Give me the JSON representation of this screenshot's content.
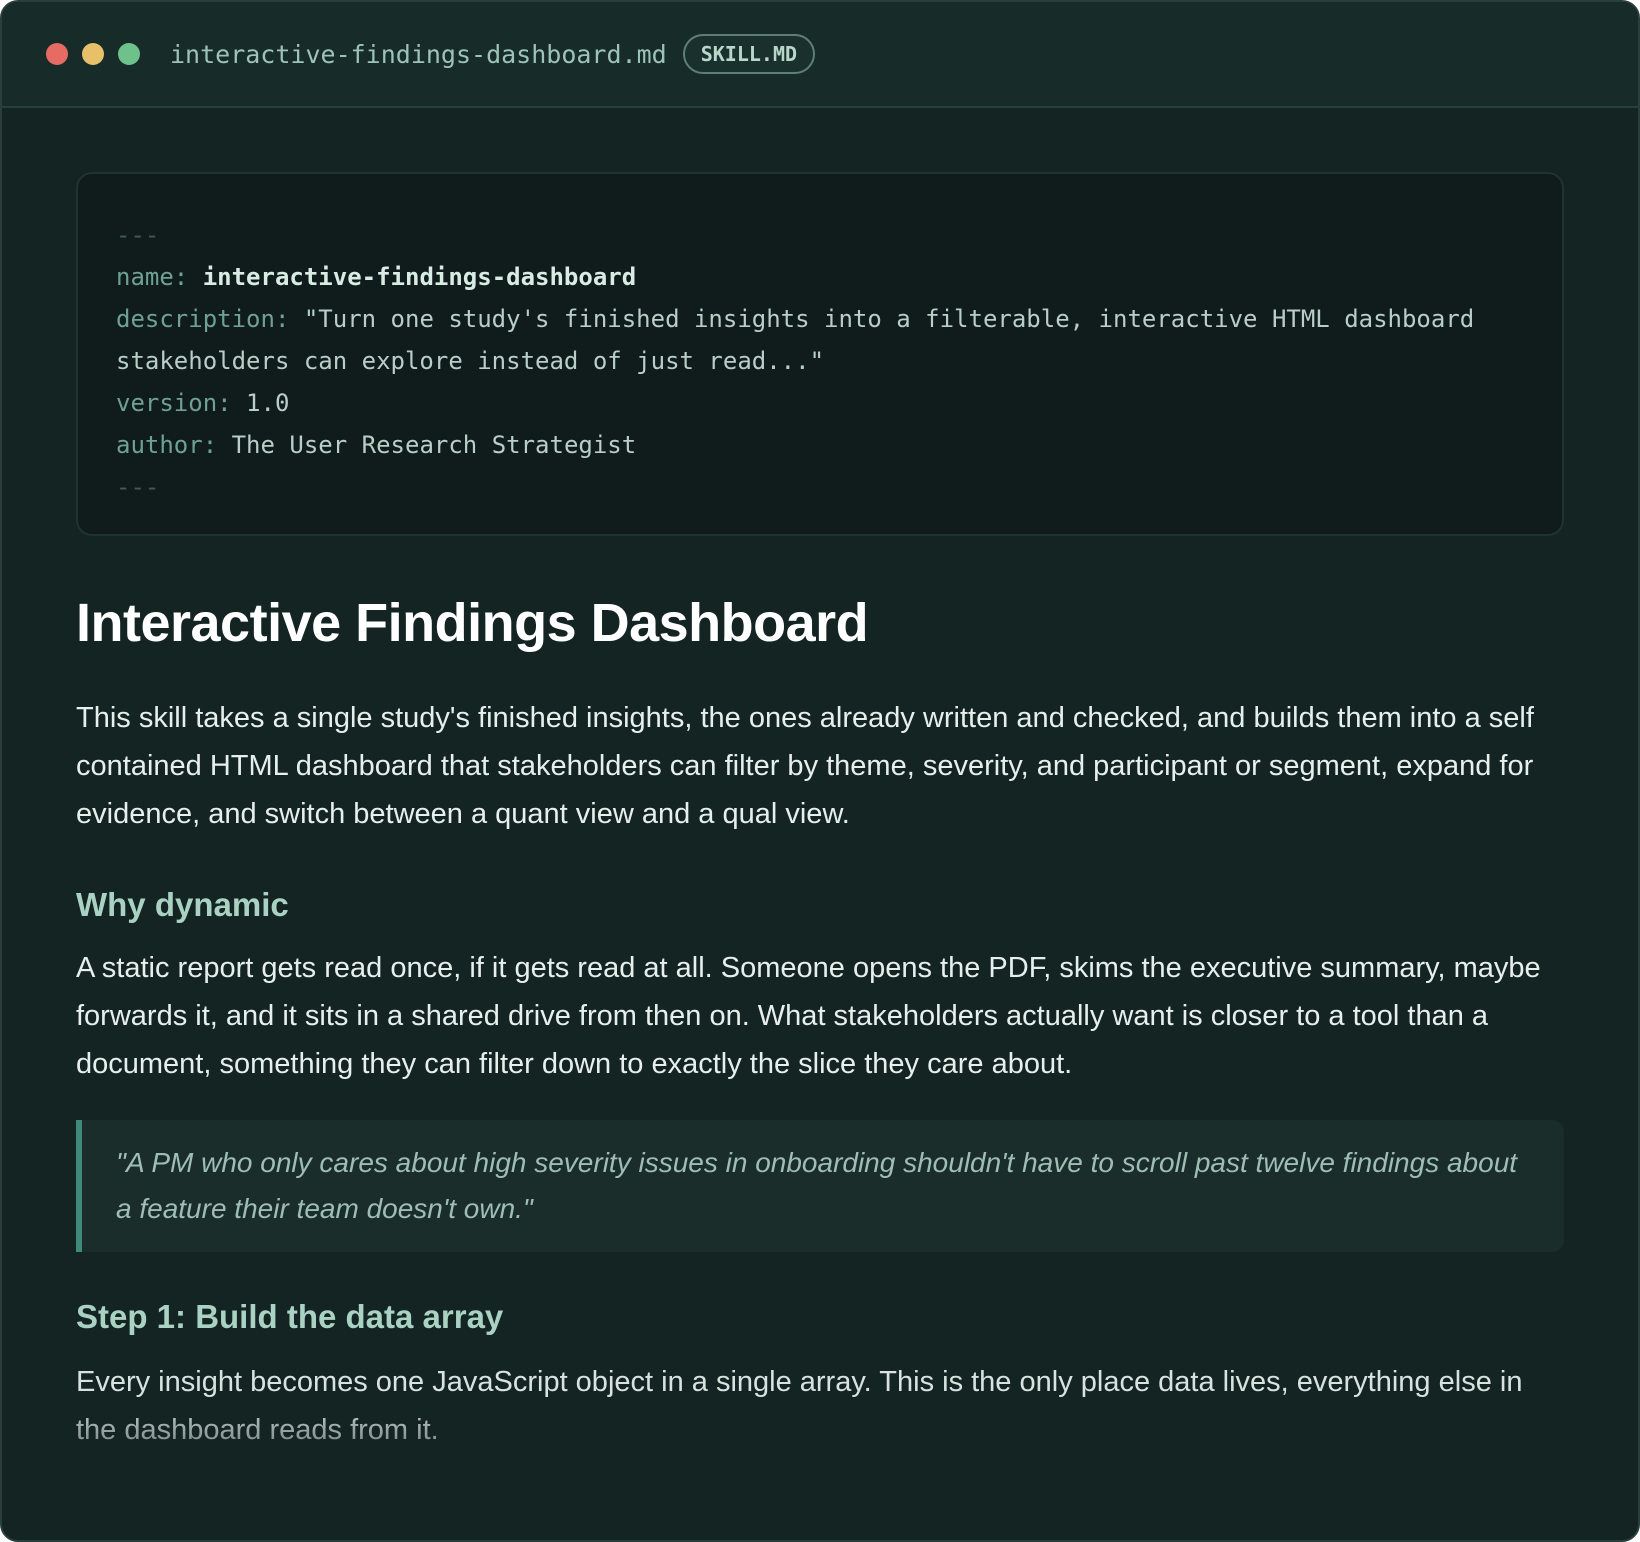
{
  "window": {
    "filename": "interactive-findings-dashboard.md",
    "badge": "SKILL.MD",
    "traffic_lights": [
      "red",
      "yellow",
      "green"
    ]
  },
  "frontmatter": {
    "delimiter": "---",
    "name_key": "name:",
    "name_value": "interactive-findings-dashboard",
    "description_key": "description:",
    "description_value": "\"Turn one study's finished insights into a filterable, interactive HTML dashboard stakeholders can explore instead of just read...\"",
    "version_key": "version:",
    "version_value": "1.0",
    "author_key": "author:",
    "author_value": "The User Research Strategist"
  },
  "doc": {
    "title": "Interactive Findings Dashboard",
    "intro": "This skill takes a single study's finished insights, the ones already written and checked, and builds them into a self contained HTML dashboard that stakeholders can filter by theme, severity, and participant or segment, expand for evidence, and switch between a quant view and a qual view.",
    "why_heading": "Why dynamic",
    "why_body": "A static report gets read once, if it gets read at all. Someone opens the PDF, skims the executive summary, maybe forwards it, and it sits in a shared drive from then on. What stakeholders actually want is closer to a tool than a document, something they can filter down to exactly the slice they care about.",
    "quote": "\"A PM who only cares about high severity issues in onboarding shouldn't have to scroll past twelve findings about a feature their team doesn't own.\"",
    "step1_heading": "Step 1: Build the data array",
    "step1_body": "Every insight becomes one JavaScript object in a single array. This is the only place data lives, everything else in the dashboard reads from it."
  },
  "colors": {
    "background": "#132423",
    "titlebar": "#172b29",
    "accent": "#3f8a7b",
    "heading_accent": "#a9d2c3"
  }
}
